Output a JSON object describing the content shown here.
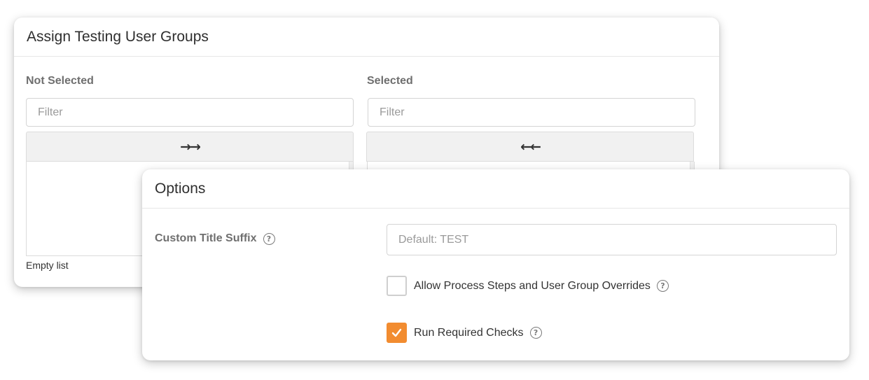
{
  "assign_card": {
    "title": "Assign Testing User Groups",
    "not_selected": {
      "heading": "Not Selected",
      "filter_placeholder": "Filter",
      "move_label": "→→",
      "empty_text": "Empty list"
    },
    "selected": {
      "heading": "Selected",
      "filter_placeholder": "Filter",
      "move_label": "←←"
    }
  },
  "options_card": {
    "title": "Options",
    "custom_title_suffix": {
      "label": "Custom Title Suffix",
      "placeholder": "Default: TEST",
      "value": ""
    },
    "allow_overrides": {
      "label": "Allow Process Steps and User Group Overrides",
      "checked": false
    },
    "run_required_checks": {
      "label": "Run Required Checks",
      "checked": true
    },
    "help_glyph": "?"
  },
  "colors": {
    "accent_orange": "#f28c30",
    "heading_gray": "#6f6f6f",
    "placeholder_gray": "#9a9a9a"
  },
  "icons": {
    "help": "help-circle-icon",
    "check": "checkmark-icon",
    "move_right": "double-arrow-right-icon",
    "move_left": "double-arrow-left-icon"
  }
}
